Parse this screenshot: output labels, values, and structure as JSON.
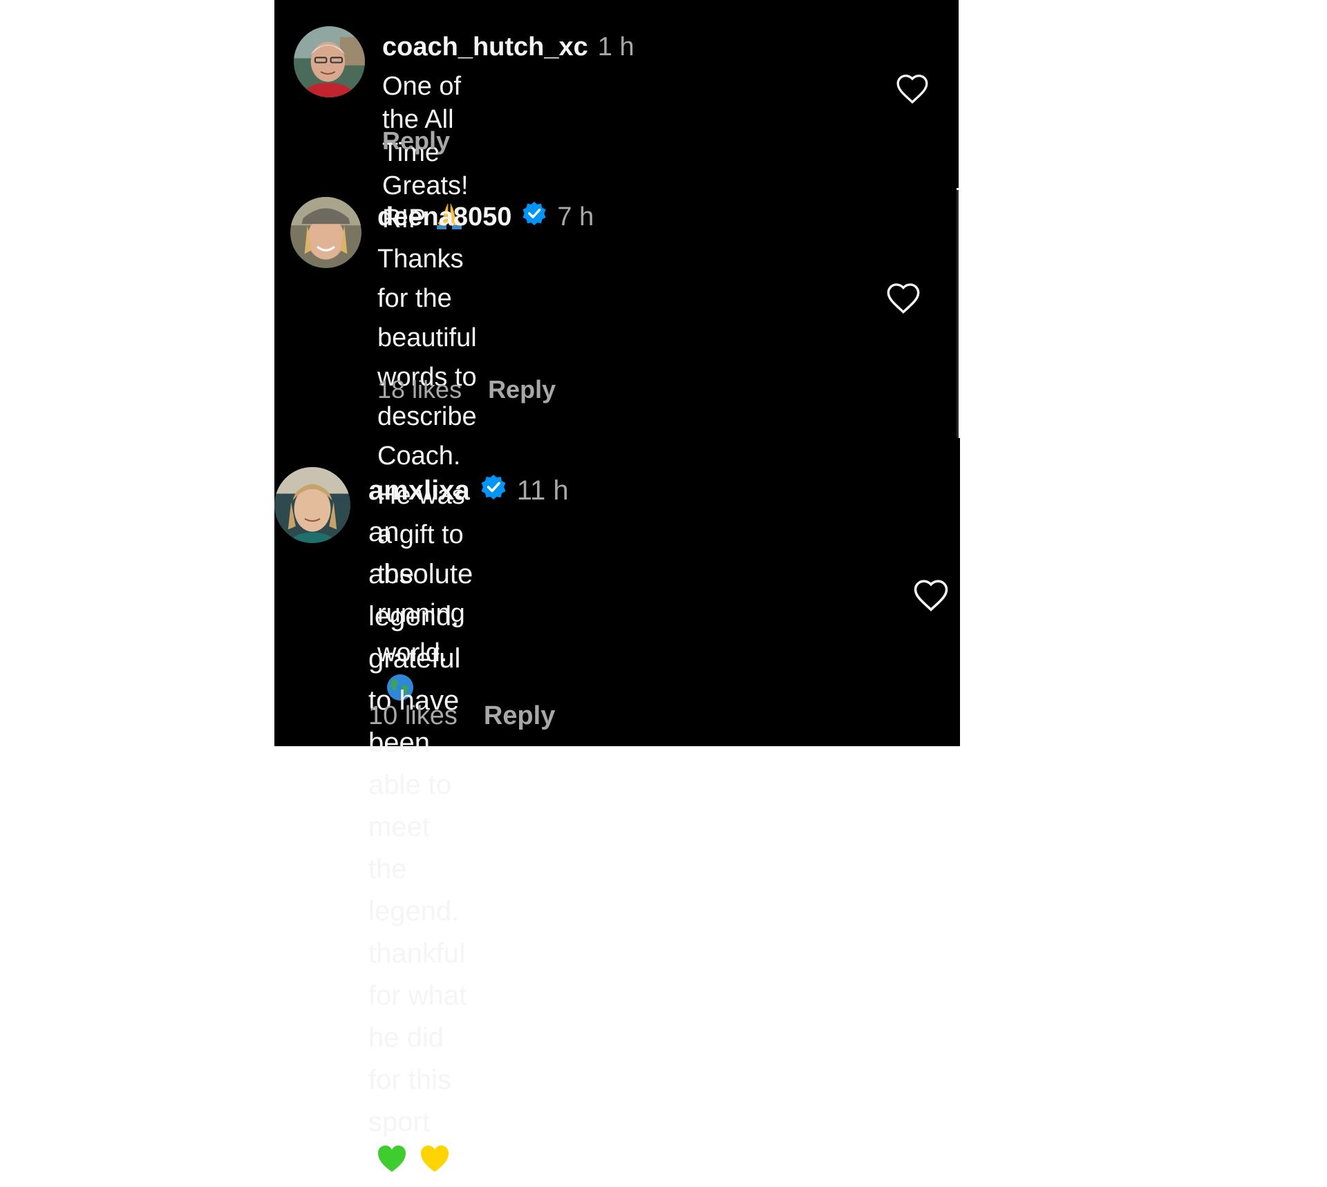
{
  "comments": [
    {
      "username": "coach_hutch_xc",
      "verified": false,
      "time": "1 h",
      "text": "One of the All Time Greats! RIP",
      "emoji": "folded-hands-emoji",
      "likes": "",
      "reply_label": "Reply"
    },
    {
      "username": "deena8050",
      "verified": true,
      "time": "7 h",
      "text": "Thanks for the beautiful words to\ndescribe Coach. He was a gift to the\nrunning world.",
      "emoji": "globe-emoji",
      "likes": "18 likes",
      "reply_label": "Reply"
    },
    {
      "username": "amxlixa",
      "verified": true,
      "time": "11 h",
      "text": "an absolute legend. grateful to have\nbeen able to meet the legend.\nthankful for what he did for this\nsport",
      "emoji": "green-heart-and-yellow-heart-emoji",
      "likes": "10 likes",
      "reply_label": "Reply"
    }
  ],
  "colors": {
    "background": "#000000",
    "text_primary": "#f5f5f5",
    "text_secondary": "#a8a8a8",
    "verified_blue": "#0095f6",
    "outer_background": "#ffffff"
  },
  "icons": {
    "like": "heart-outline-icon",
    "verified": "verified-badge-icon"
  }
}
